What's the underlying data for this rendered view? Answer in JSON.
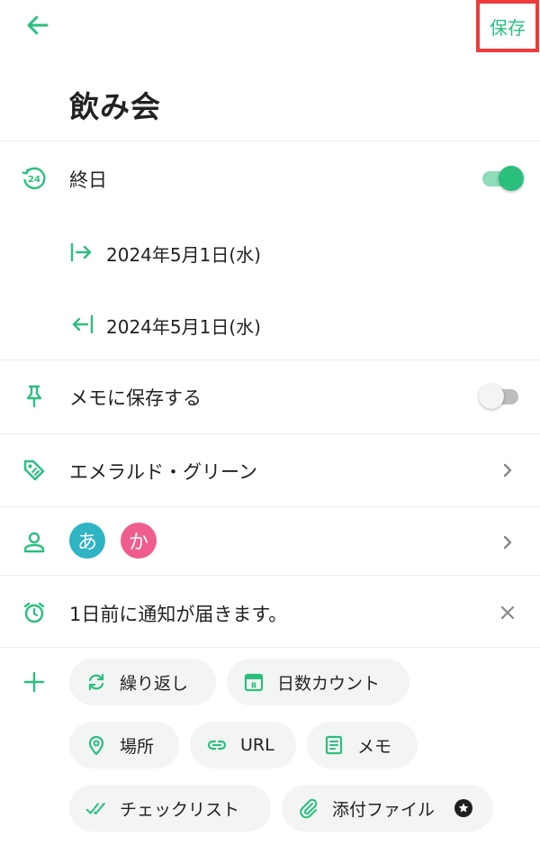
{
  "header": {
    "back_icon": "arrow-left-icon",
    "save_label": "保存"
  },
  "event": {
    "title": "飲み会"
  },
  "all_day": {
    "label": "終日",
    "enabled": true,
    "icon": "24h-icon"
  },
  "start": {
    "date": "2024年5月1日(水)",
    "icon": "start-arrow-icon"
  },
  "end": {
    "date": "2024年5月1日(水)",
    "icon": "end-arrow-icon"
  },
  "memo_save": {
    "label": "メモに保存する",
    "enabled": false,
    "icon": "pin-icon"
  },
  "color": {
    "label": "エメラルド・グリーン",
    "icon": "tag-icon"
  },
  "members": {
    "icon": "person-icon",
    "avatars": [
      {
        "char": "あ",
        "color": "#2fb4c4"
      },
      {
        "char": "か",
        "color": "#ee5d8e"
      }
    ]
  },
  "notification": {
    "label": "1日前に通知が届きます。",
    "icon": "alarm-icon"
  },
  "chips": [
    {
      "label": "繰り返し",
      "icon": "repeat-icon"
    },
    {
      "label": "日数カウント",
      "icon": "calendar-count-icon"
    },
    {
      "label": "場所",
      "icon": "location-pin-icon"
    },
    {
      "label": "URL",
      "icon": "link-icon"
    },
    {
      "label": "メモ",
      "icon": "note-icon"
    },
    {
      "label": "チェックリスト",
      "icon": "checklist-icon"
    },
    {
      "label": "添付ファイル",
      "icon": "paperclip-icon",
      "premium": true
    }
  ],
  "colors": {
    "accent": "#2bbf7e",
    "highlight_border": "#ef3b3b",
    "chip_bg": "#f3f4f4",
    "divider": "#ececec"
  }
}
